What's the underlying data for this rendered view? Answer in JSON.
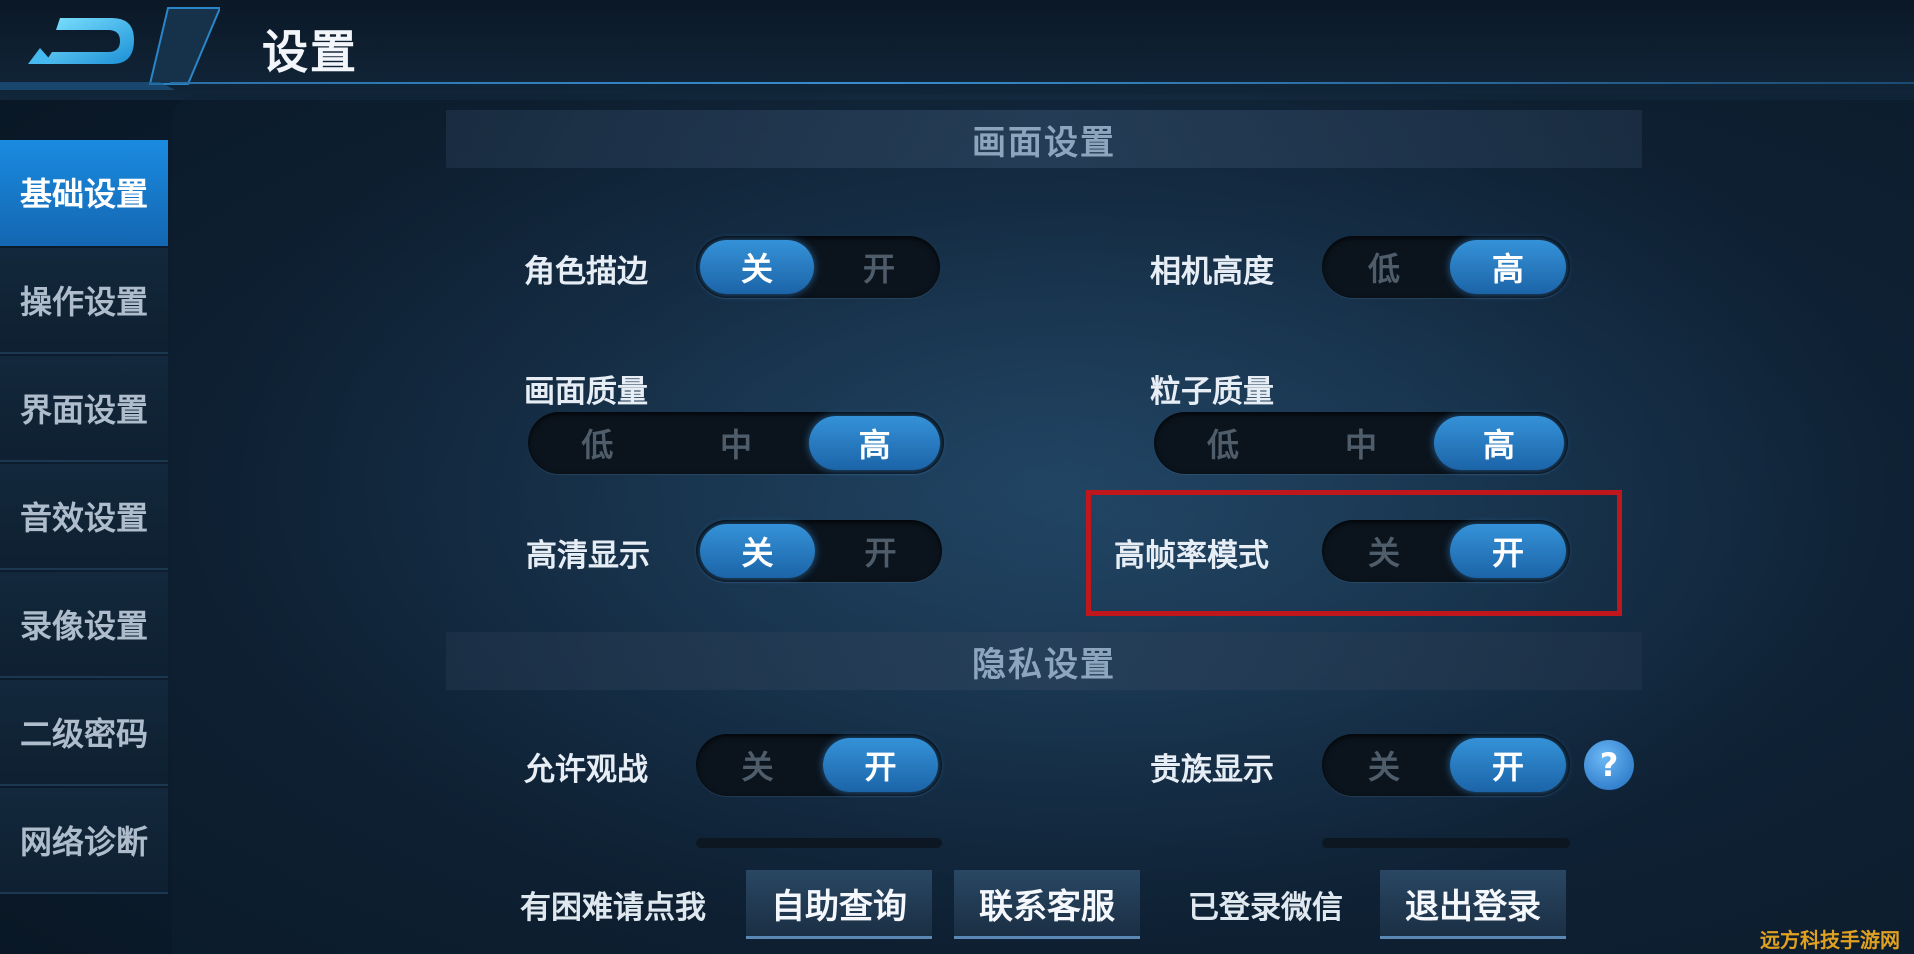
{
  "header": {
    "title": "设置"
  },
  "sidebar": {
    "items": [
      {
        "label": "基础设置",
        "active": true
      },
      {
        "label": "操作设置",
        "active": false
      },
      {
        "label": "界面设置",
        "active": false
      },
      {
        "label": "音效设置",
        "active": false
      },
      {
        "label": "录像设置",
        "active": false
      },
      {
        "label": "二级密码",
        "active": false
      },
      {
        "label": "网络诊断",
        "active": false
      }
    ]
  },
  "sections": {
    "display": {
      "title": "画面设置",
      "outline": {
        "label": "角色描边",
        "options": [
          "关",
          "开"
        ],
        "selected": "关"
      },
      "camera_height": {
        "label": "相机高度",
        "options": [
          "低",
          "高"
        ],
        "selected": "高"
      },
      "image_quality": {
        "label": "画面质量",
        "options": [
          "低",
          "中",
          "高"
        ],
        "selected": "高"
      },
      "particle_quality": {
        "label": "粒子质量",
        "options": [
          "低",
          "中",
          "高"
        ],
        "selected": "高"
      },
      "hd_display": {
        "label": "高清显示",
        "options": [
          "关",
          "开"
        ],
        "selected": "关"
      },
      "high_frame_rate": {
        "label": "高帧率模式",
        "options": [
          "关",
          "开"
        ],
        "selected": "开"
      }
    },
    "privacy": {
      "title": "隐私设置",
      "allow_spectate": {
        "label": "允许观战",
        "options": [
          "关",
          "开"
        ],
        "selected": "开"
      },
      "noble_display": {
        "label": "贵族显示",
        "options": [
          "关",
          "开"
        ],
        "selected": "开"
      },
      "help_icon": "?"
    }
  },
  "footer": {
    "help_text": "有困难请点我",
    "self_service_label": "自助查询",
    "contact_label": "联系客服",
    "wechat_status": "已登录微信",
    "logout_label": "退出登录"
  },
  "watermark": "远方科技手游网",
  "colors": {
    "accent": "#1f7fd0",
    "highlight_box": "#c0171d",
    "background": "#0f2236"
  }
}
